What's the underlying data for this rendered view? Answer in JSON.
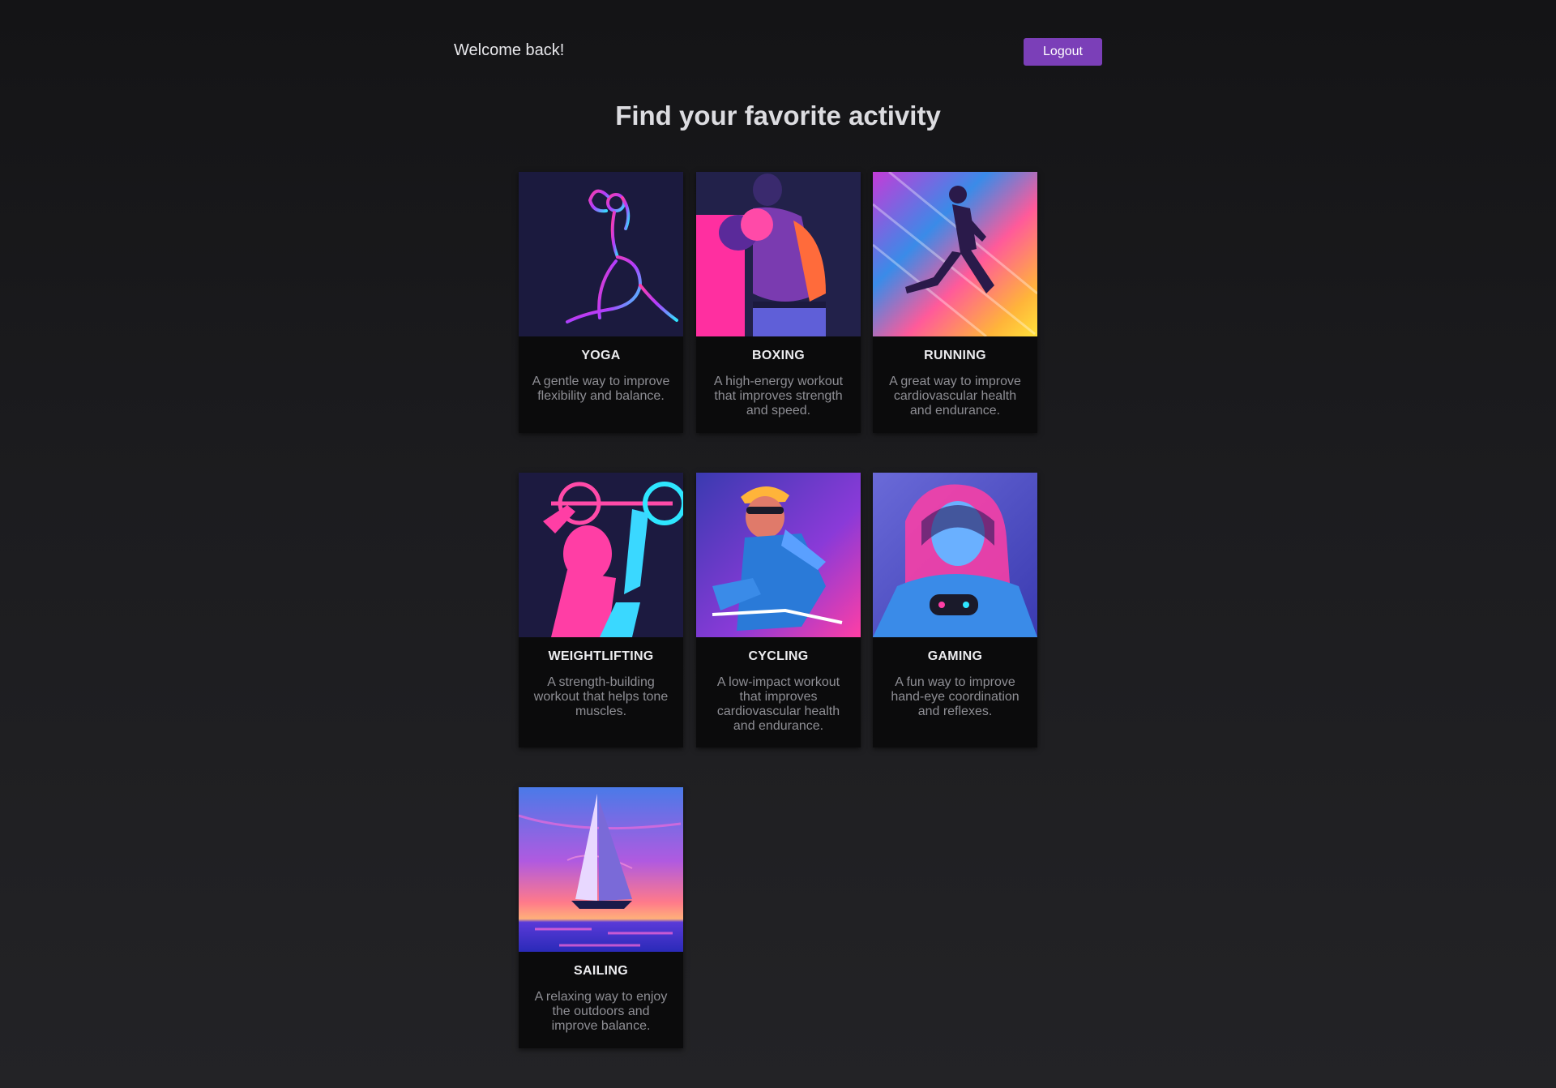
{
  "header": {
    "welcome": "Welcome back!",
    "logout_label": "Logout",
    "logout_color": "#7b3fb8"
  },
  "page_title": "Find your favorite activity",
  "activities": [
    {
      "title": "YOGA",
      "description": "A gentle way to improve flexibility and balance.",
      "image": "yoga-pose-illustration"
    },
    {
      "title": "BOXING",
      "description": "A high-energy workout that improves strength and speed.",
      "image": "boxer-illustration"
    },
    {
      "title": "RUNNING",
      "description": "A great way to improve cardiovascular health and endurance.",
      "image": "runner-illustration"
    },
    {
      "title": "WEIGHTLIFTING",
      "description": "A strength-building workout that helps tone muscles.",
      "image": "weightlifter-illustration"
    },
    {
      "title": "CYCLING",
      "description": "A low-impact workout that improves cardiovascular health and endurance.",
      "image": "cyclist-illustration"
    },
    {
      "title": "GAMING",
      "description": "A fun way to improve hand-eye coordination and reflexes.",
      "image": "gamer-illustration"
    },
    {
      "title": "SAILING",
      "description": "A relaxing way to enjoy the outdoors and improve balance.",
      "image": "sailboat-illustration"
    }
  ]
}
